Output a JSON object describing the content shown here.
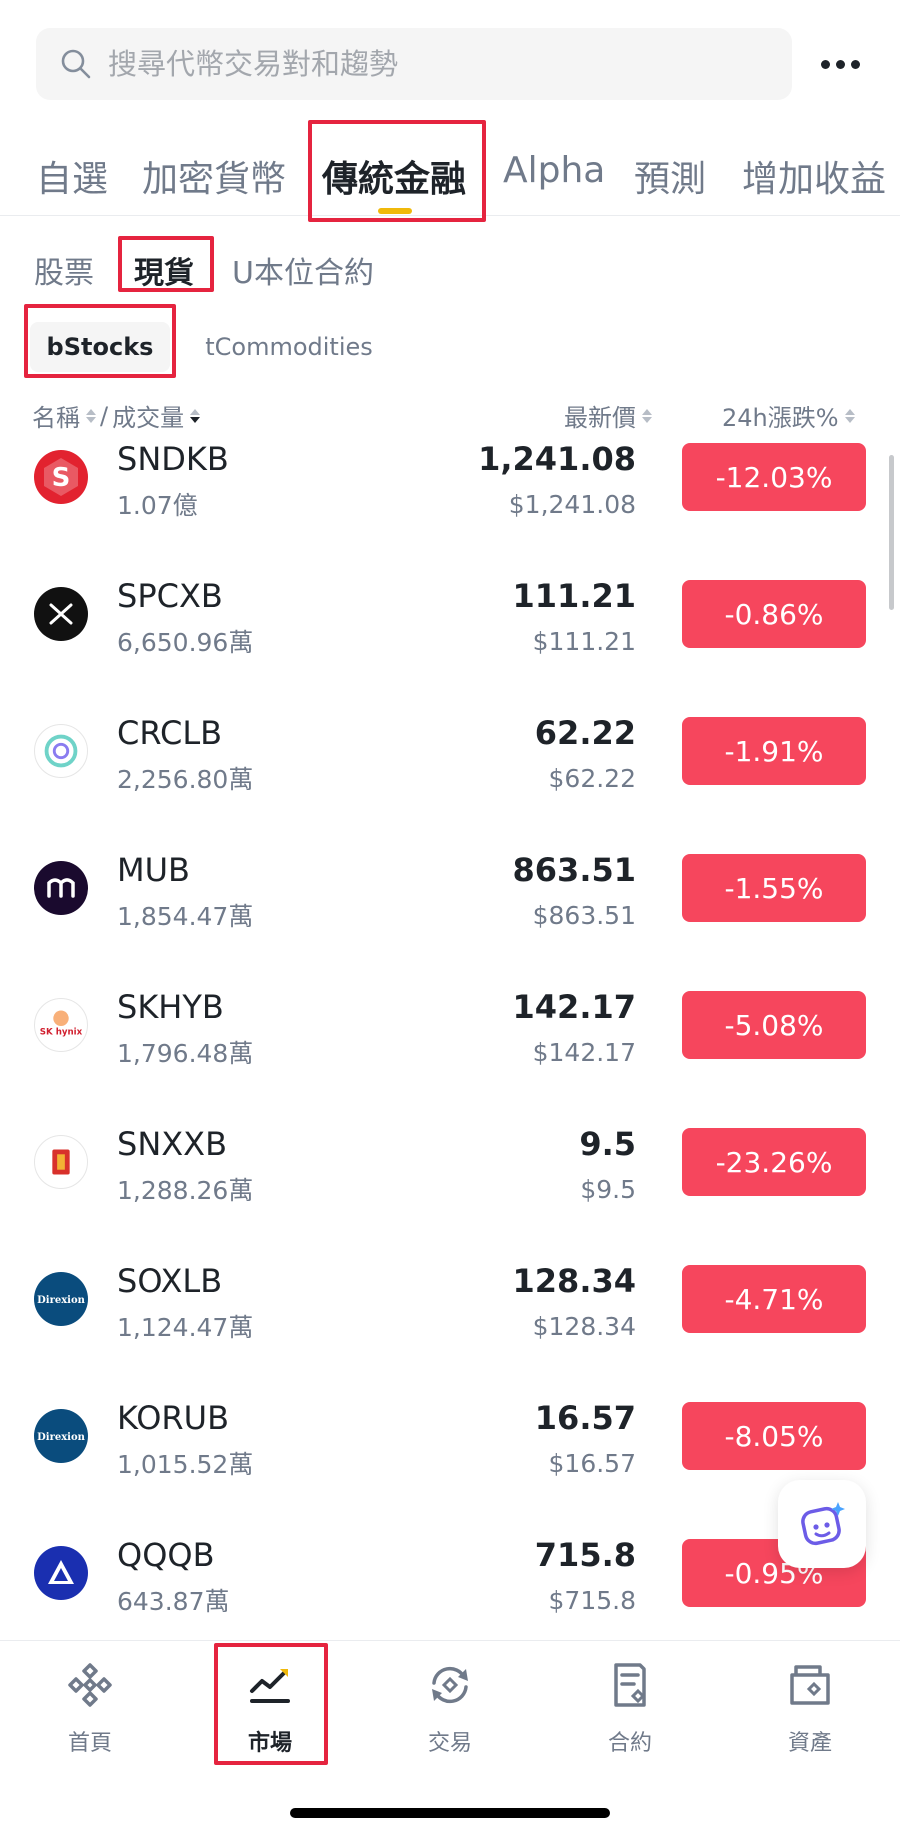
{
  "search": {
    "placeholder": "搜尋代幣交易對和趨勢"
  },
  "top_tabs": [
    {
      "label": "自選"
    },
    {
      "label": "加密貨幣"
    },
    {
      "label": "傳統金融",
      "active": true
    },
    {
      "label": "Alpha"
    },
    {
      "label": "預測"
    },
    {
      "label": "增加收益"
    }
  ],
  "sub_tabs": [
    {
      "label": "股票"
    },
    {
      "label": "現貨",
      "active": true
    },
    {
      "label": "U本位合約"
    }
  ],
  "chips": [
    {
      "label": "bStocks",
      "active": true
    },
    {
      "label": "tCommodities"
    }
  ],
  "columns": {
    "name": "名稱",
    "separator": "/",
    "volume": "成交量",
    "price": "最新價",
    "change": "24h漲跌%"
  },
  "rows": [
    {
      "symbol": "SNDKB",
      "volume": "1.07億",
      "price": "1,241.08",
      "fiat": "$1,241.08",
      "change": "-12.03%"
    },
    {
      "symbol": "SPCXB",
      "volume": "6,650.96萬",
      "price": "111.21",
      "fiat": "$111.21",
      "change": "-0.86%"
    },
    {
      "symbol": "CRCLB",
      "volume": "2,256.80萬",
      "price": "62.22",
      "fiat": "$62.22",
      "change": "-1.91%"
    },
    {
      "symbol": "MUB",
      "volume": "1,854.47萬",
      "price": "863.51",
      "fiat": "$863.51",
      "change": "-1.55%"
    },
    {
      "symbol": "SKHYB",
      "volume": "1,796.48萬",
      "price": "142.17",
      "fiat": "$142.17",
      "change": "-5.08%"
    },
    {
      "symbol": "SNXXB",
      "volume": "1,288.26萬",
      "price": "9.5",
      "fiat": "$9.5",
      "change": "-23.26%"
    },
    {
      "symbol": "SOXLB",
      "volume": "1,124.47萬",
      "price": "128.34",
      "fiat": "$128.34",
      "change": "-4.71%"
    },
    {
      "symbol": "KORUB",
      "volume": "1,015.52萬",
      "price": "16.57",
      "fiat": "$16.57",
      "change": "-8.05%"
    },
    {
      "symbol": "QQQB",
      "volume": "643.87萬",
      "price": "715.8",
      "fiat": "$715.8",
      "change": "-0.95%"
    }
  ],
  "icons": {
    "SNDKB": "sandisk-logo-icon",
    "SPCXB": "spacex-logo-icon",
    "CRCLB": "circle-logo-icon",
    "MUB": "micron-logo-icon",
    "SKHYB": "sk-hynix-logo-icon",
    "SNXXB": "snxx-logo-icon",
    "SOXLB": "direxion-logo-icon",
    "KORUB": "direxion-logo-icon",
    "QQQB": "qqq-logo-icon"
  },
  "icon_text": {
    "SKHYB": "SK hynix",
    "SOXLB": "Direxion",
    "KORUB": "Direxion"
  },
  "bottom_nav": [
    {
      "label": "首頁",
      "icon": "home-icon"
    },
    {
      "label": "市場",
      "icon": "market-chart-icon",
      "active": true
    },
    {
      "label": "交易",
      "icon": "trade-icon"
    },
    {
      "label": "合約",
      "icon": "futures-icon"
    },
    {
      "label": "資產",
      "icon": "wallet-icon"
    }
  ],
  "colors": {
    "accent": "#f0b90b",
    "down": "#f6465d",
    "highlight_box": "#e5243f",
    "text_primary": "#1e2329",
    "text_secondary": "#707a8a"
  }
}
